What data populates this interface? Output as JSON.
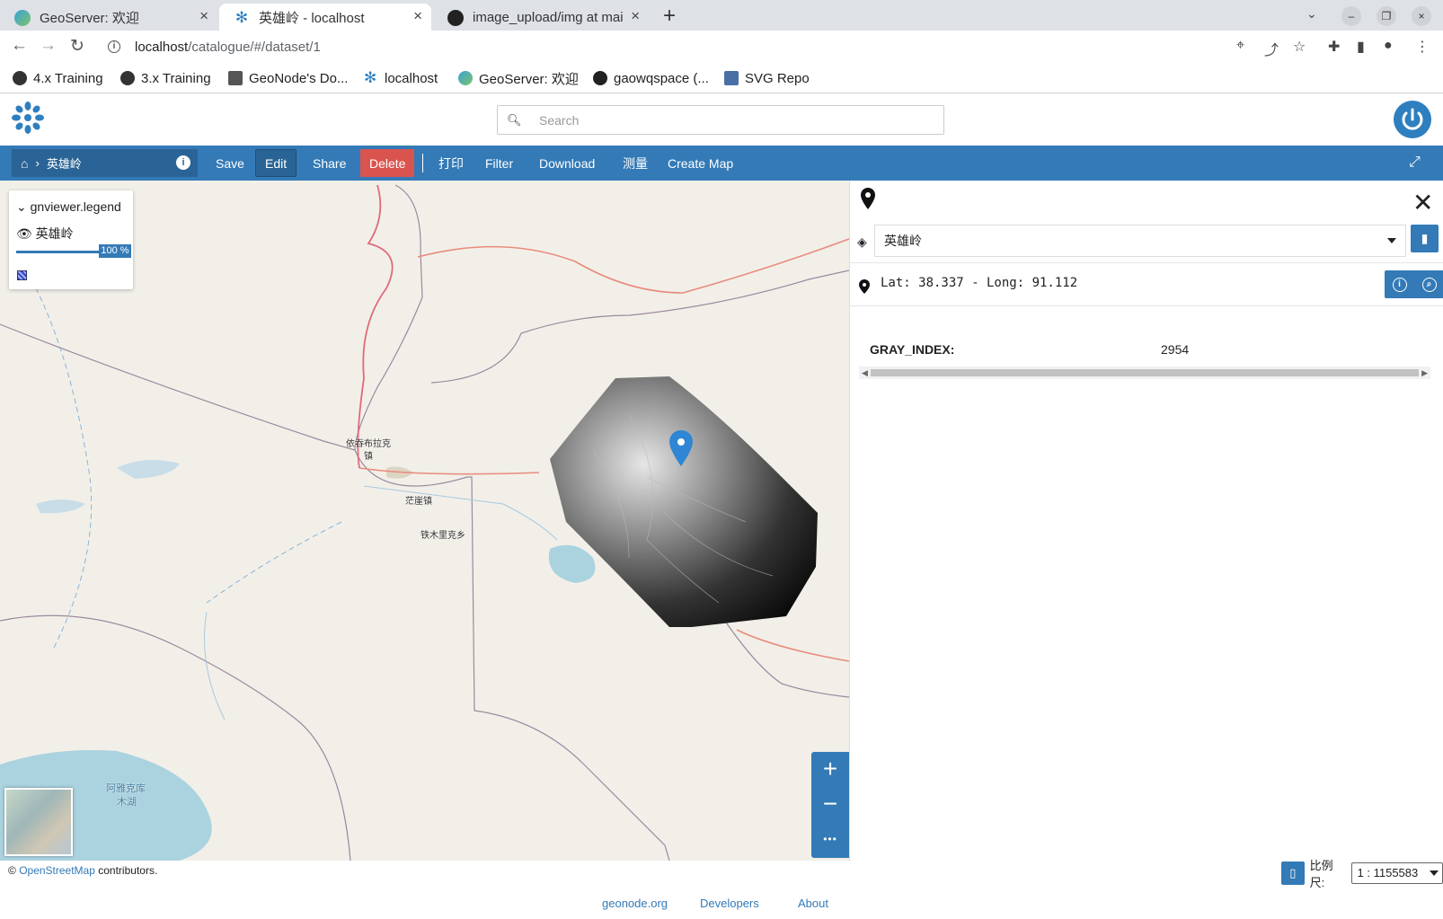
{
  "browser": {
    "tabs": [
      {
        "title": "GeoServer: 欢迎",
        "active": false
      },
      {
        "title": "英雄岭 - localhost",
        "active": true
      },
      {
        "title": "image_upload/img at mai",
        "active": false
      }
    ],
    "new_tab": "+",
    "url_host": "localhost",
    "url_path": "/catalogue/#/dataset/1",
    "bookmarks": [
      "4.x Training",
      "3.x Training",
      "GeoNode's Do...",
      "localhost",
      "GeoServer: 欢迎",
      "gaowqspace (...",
      "SVG Repo"
    ]
  },
  "header": {
    "search_placeholder": "Search"
  },
  "toolbar": {
    "breadcrumb_title": "英雄岭",
    "buttons": {
      "save": "Save",
      "edit": "Edit",
      "share": "Share",
      "delete": "Delete",
      "print": "打印",
      "filter": "Filter",
      "download": "Download",
      "measure": "测量",
      "create_map": "Create Map"
    }
  },
  "legend": {
    "header": "gnviewer.legend",
    "layer_name": "英雄岭",
    "opacity": "100 %"
  },
  "map": {
    "place_labels": [
      "依吞布拉克",
      "镇",
      "茫崖镇",
      "铁木里克乡",
      "阿雅克库",
      "木湖"
    ],
    "zoom_in": "+",
    "zoom_out": "−",
    "more": "•••",
    "attribution_prefix": "©",
    "attribution_link": "OpenStreetMap",
    "attribution_suffix": "contributors."
  },
  "identify": {
    "layer_selected": "英雄岭",
    "coordinates": "Lat: 38.337 - Long: 91.112",
    "attribute_key": "GRAY_INDEX:",
    "attribute_value": "2954"
  },
  "scale": {
    "label": "比例尺:",
    "value": "1 : 1155583"
  },
  "footer": {
    "links": [
      "geonode.org",
      "Developers",
      "About"
    ]
  },
  "colors": {
    "primary": "#337ab7",
    "delete": "#d9534f",
    "map_bg": "#f2efe9",
    "water": "#aad3df"
  }
}
